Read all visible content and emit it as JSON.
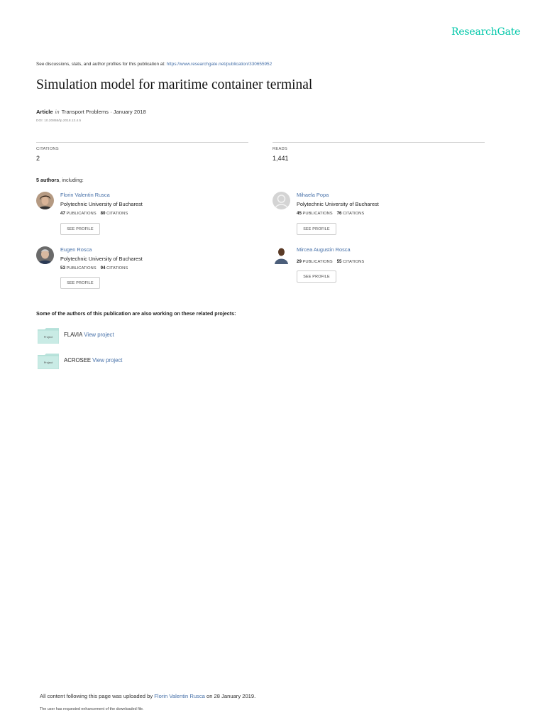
{
  "brand": {
    "name": "ResearchGate",
    "color": "#00c7a9"
  },
  "header": {
    "discuss_prefix": "See discussions, stats, and author profiles for this publication at: ",
    "discuss_url": "https://www.researchgate.net/publication/330655952"
  },
  "publication": {
    "title": "Simulation model for maritime container terminal",
    "type": "Article",
    "in_word": "in",
    "journal_date": "Transport Problems · January 2018",
    "doi": "DOI: 10.20858/tp.2018.13.4.5"
  },
  "stats": {
    "citations_label": "CITATIONS",
    "citations_value": "2",
    "reads_label": "READS",
    "reads_value": "1,441"
  },
  "authors_section": {
    "count_bold": "5 authors",
    "count_rest": ", including:"
  },
  "authors": [
    {
      "name": "Florin Valentin Rusca",
      "institution": "Polytechnic University of Bucharest",
      "publications": "47",
      "publications_label": "PUBLICATIONS",
      "citations": "80",
      "citations_label": "CITATIONS",
      "button": "SEE PROFILE",
      "avatar_icon": "author-photo-icon"
    },
    {
      "name": "Mihaela Popa",
      "institution": "Polytechnic University of Bucharest",
      "publications": "45",
      "publications_label": "PUBLICATIONS",
      "citations": "76",
      "citations_label": "CITATIONS",
      "button": "SEE PROFILE",
      "avatar_icon": "default-avatar-icon"
    },
    {
      "name": "Eugen Rosca",
      "institution": "Polytechnic University of Bucharest",
      "publications": "53",
      "publications_label": "PUBLICATIONS",
      "citations": "94",
      "citations_label": "CITATIONS",
      "button": "SEE PROFILE",
      "avatar_icon": "author-photo-icon"
    },
    {
      "name": "Mircea Augustin Rosca",
      "institution": "",
      "publications": "29",
      "publications_label": "PUBLICATIONS",
      "citations": "55",
      "citations_label": "CITATIONS",
      "button": "SEE PROFILE",
      "avatar_icon": "author-photo-icon"
    }
  ],
  "related": {
    "heading": "Some of the authors of this publication are also working on these related projects:",
    "icon_label": "Project",
    "projects": [
      {
        "name": "FLAVIA",
        "link": "View project"
      },
      {
        "name": "ACROSEE",
        "link": "View project"
      }
    ]
  },
  "footer": {
    "uploaded_prefix": "All content following this page was uploaded by ",
    "uploader": "Florin Valentin Rusca",
    "uploaded_suffix": " on 28 January 2019.",
    "enhancement": "The user has requested enhancement of the downloaded file."
  },
  "colors": {
    "link": "#4670a8",
    "project_folder": "#c9ebe5"
  }
}
